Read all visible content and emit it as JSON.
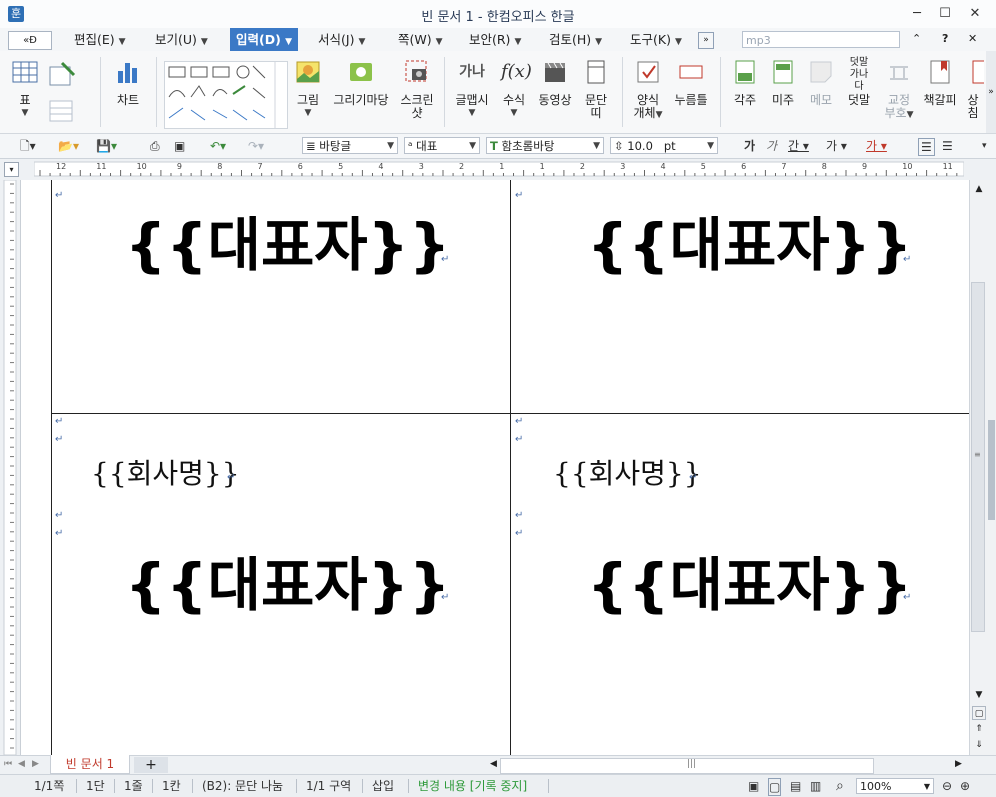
{
  "window": {
    "title": "빈 문서 1 - 한컴오피스 한글"
  },
  "menu": {
    "items": [
      {
        "label": "편집(E)"
      },
      {
        "label": "보기(U)"
      },
      {
        "label": "입력(D)"
      },
      {
        "label": "서식(J)"
      },
      {
        "label": "쪽(W)"
      },
      {
        "label": "보안(R)"
      },
      {
        "label": "검토(H)"
      },
      {
        "label": "도구(K)"
      }
    ],
    "search_value": "mp3"
  },
  "ribbon": {
    "table": "표",
    "chart": "차트",
    "picture": "그림",
    "drawing_market": "그리기마당",
    "screenshot_line1": "스크린",
    "screenshot_line2": "샷",
    "wordart": "글맵시",
    "formula": "수식",
    "video": "동영상",
    "para_line1": "문단",
    "para_line2": "띠",
    "form_line1": "양식",
    "form_line2": "개체",
    "pressbar": "누름틀",
    "footnote": "각주",
    "endnote": "미주",
    "memo": "메모",
    "overlap": "덧말",
    "overlap_icon_top": "덧말",
    "overlap_icon_bottom": "가나다",
    "proofmark_line1": "교정",
    "proofmark_line2": "부호",
    "bookmark": "책갈피",
    "more_line1": "상",
    "more_line2": "침"
  },
  "format_toolbar": {
    "style": "바탕글",
    "lang": "대표",
    "font": "함초롬바탕",
    "size": "10.0",
    "unit": "pt"
  },
  "ruler": {
    "numbers": [
      "12",
      "11",
      "10",
      "9",
      "8",
      "7",
      "6",
      "5",
      "4",
      "3",
      "2",
      "1",
      "1",
      "2",
      "3",
      "4",
      "5",
      "6",
      "7",
      "8",
      "9",
      "10",
      "11"
    ]
  },
  "document": {
    "representative": "{{대표자}}",
    "company": "{{회사명}}",
    "para_mark": "↵"
  },
  "tabs": {
    "doc_tab": "빈 문서 1",
    "add": "+"
  },
  "status": {
    "page": "1/1쪽",
    "column": "1단",
    "line": "1줄",
    "char": "1칸",
    "cell": "(B2): 문단 나눔",
    "section": "1/1 구역",
    "mode": "삽입",
    "track": "변경 내용 [기록 중지]",
    "zoom": "100%"
  },
  "colors": {
    "accent": "#3b79c6",
    "track_green": "#2e9a3a",
    "tab_red": "#c0392b"
  }
}
